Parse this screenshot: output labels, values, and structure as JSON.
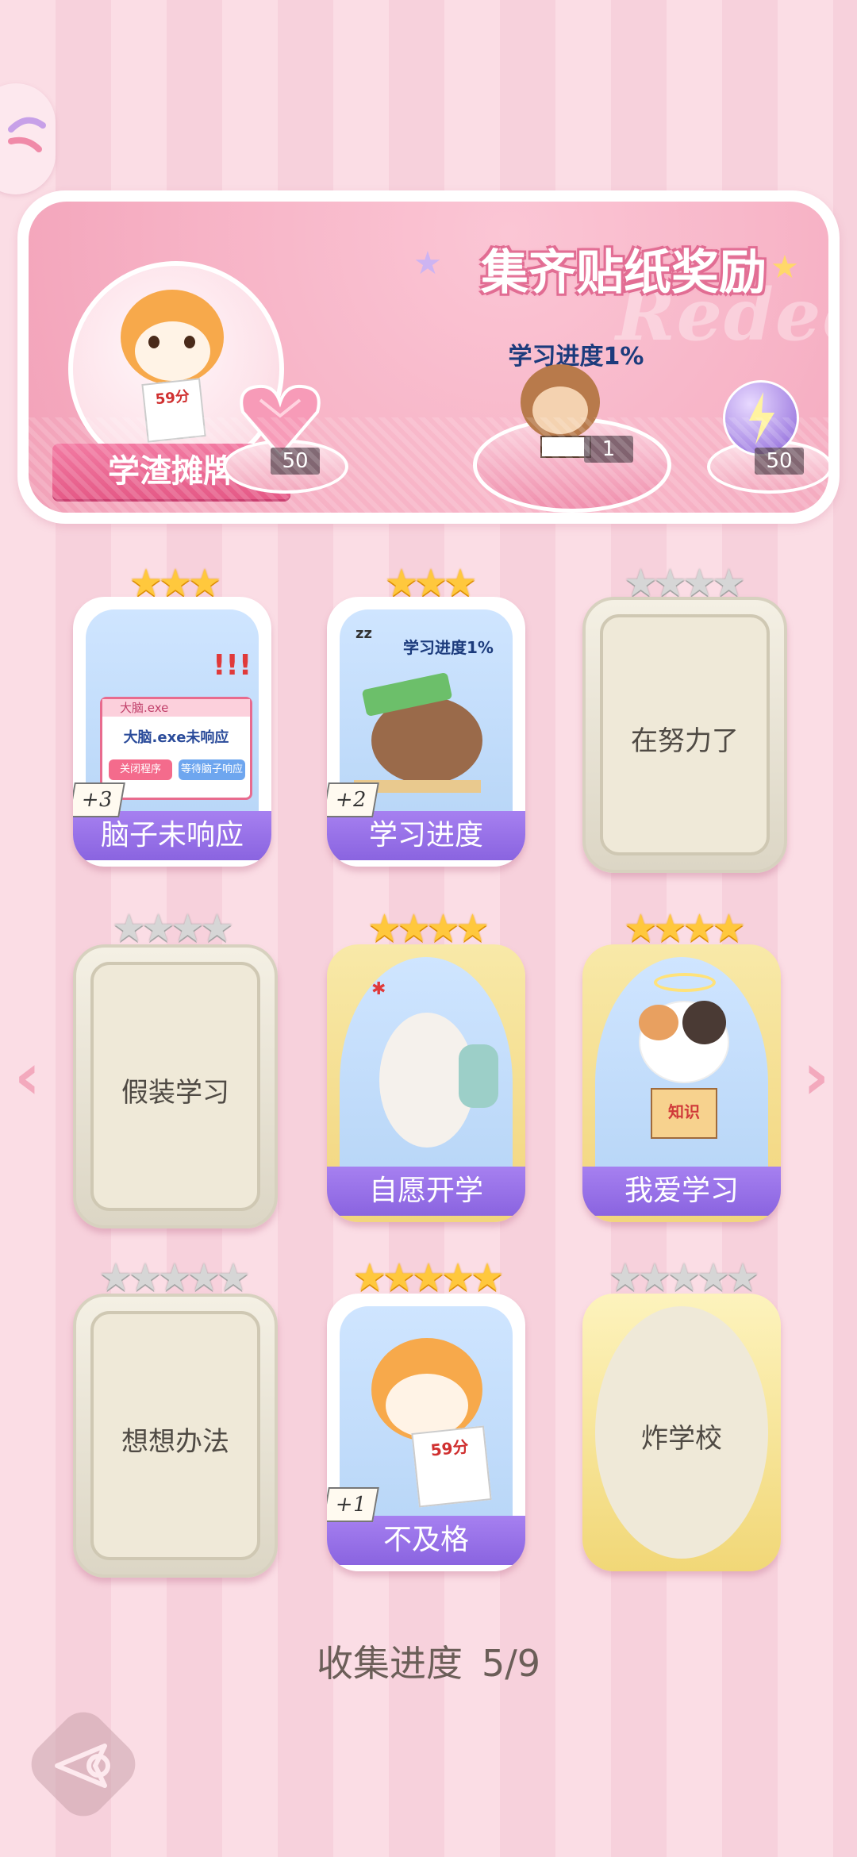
{
  "banner": {
    "title": "集齐贴纸奖励",
    "watermark": "Redeem",
    "character_label": "学渣摊牌",
    "avatar_paper_text": "59分",
    "center_caption": "学习进度1%",
    "rewards": [
      {
        "icon": "pink-heart-gem-icon",
        "count": "50"
      },
      {
        "icon": "monkey-studying-icon",
        "count": "1"
      },
      {
        "icon": "lightning-orb-icon",
        "count": "50"
      }
    ]
  },
  "cards": [
    {
      "name": "脑子未响应",
      "stars": 3,
      "max": 3,
      "unlocked": true,
      "extra": "+3",
      "art_text": [
        "大脑.exe",
        "大脑.exe未响应",
        "关闭程序",
        "等待脑子响应"
      ]
    },
    {
      "name": "学习进度",
      "stars": 3,
      "max": 3,
      "unlocked": true,
      "extra": "+2",
      "art_text": [
        "学习进度1%",
        "zz"
      ]
    },
    {
      "name": "在努力了",
      "stars": 0,
      "max": 4,
      "unlocked": false
    },
    {
      "name": "假装学习",
      "stars": 0,
      "max": 4,
      "unlocked": false
    },
    {
      "name": "自愿开学",
      "stars": 4,
      "max": 4,
      "unlocked": true
    },
    {
      "name": "我爱学习",
      "stars": 4,
      "max": 4,
      "unlocked": true,
      "art_text": [
        "知识"
      ]
    },
    {
      "name": "想想办法",
      "stars": 0,
      "max": 5,
      "unlocked": false
    },
    {
      "name": "不及格",
      "stars": 5,
      "max": 5,
      "unlocked": true,
      "extra": "+1",
      "art_text": [
        "59分"
      ]
    },
    {
      "name": "炸学校",
      "stars": 0,
      "max": 5,
      "unlocked": false
    }
  ],
  "progress": {
    "label": "收集进度",
    "value": "5/9"
  },
  "nav": {
    "prev": "‹",
    "next": "›"
  },
  "colors": {
    "accent": "#8a64e0",
    "star_gold": "#ffc83d",
    "banner_pink": "#f7b3c6"
  }
}
